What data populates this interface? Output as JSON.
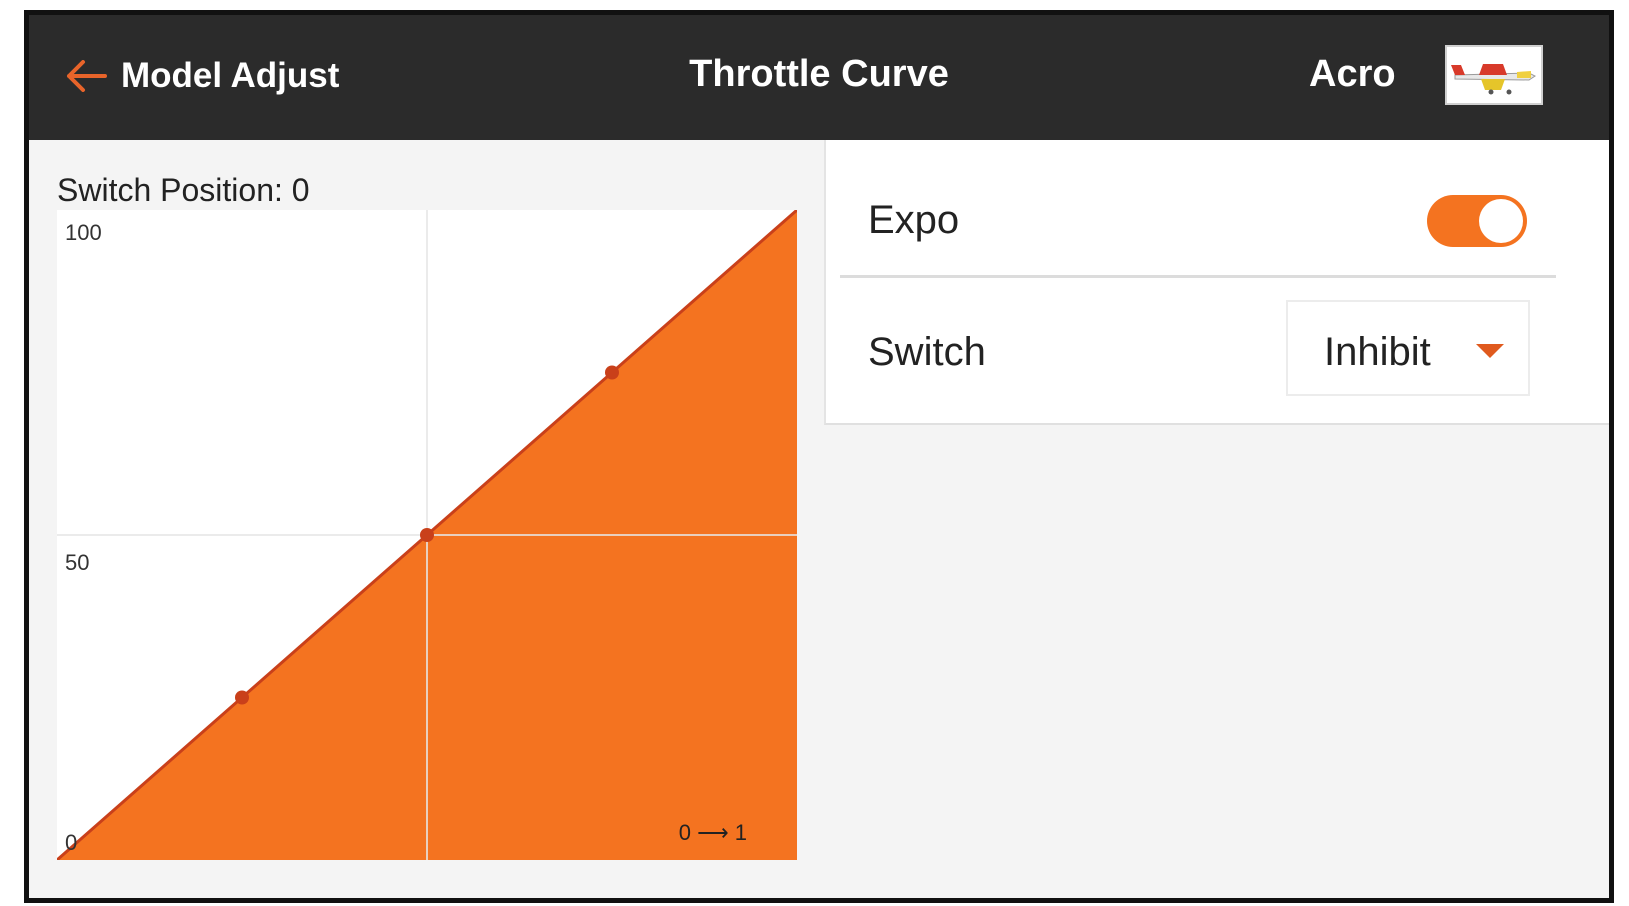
{
  "header": {
    "back_label": "Model Adjust",
    "title": "Throttle Curve",
    "model_name": "Acro",
    "model_thumbnail_icon": "airplane-icon"
  },
  "left_panel": {
    "switch_position_label": "Switch Position: 0"
  },
  "chart_data": {
    "type": "area",
    "title": "",
    "xlabel": "",
    "ylabel": "",
    "x": [
      0,
      25,
      50,
      75,
      100
    ],
    "series": [
      {
        "values": [
          0,
          25,
          50,
          75,
          100
        ]
      }
    ],
    "xlim": [
      0,
      100
    ],
    "ylim": [
      0,
      100
    ],
    "y_tick_labels": [
      "100",
      "50",
      "0"
    ],
    "direction_label": "0 ⟶ 1",
    "grid": true,
    "fill_color": "#f47320",
    "line_color": "#c9401a",
    "point_color": "#c9401a"
  },
  "settings": {
    "expo": {
      "label": "Expo",
      "enabled": true
    },
    "switch": {
      "label": "Switch",
      "value": "Inhibit"
    }
  },
  "colors": {
    "accent": "#f47320",
    "header_bg": "#2b2b2b",
    "arrow": "#e8642a"
  }
}
